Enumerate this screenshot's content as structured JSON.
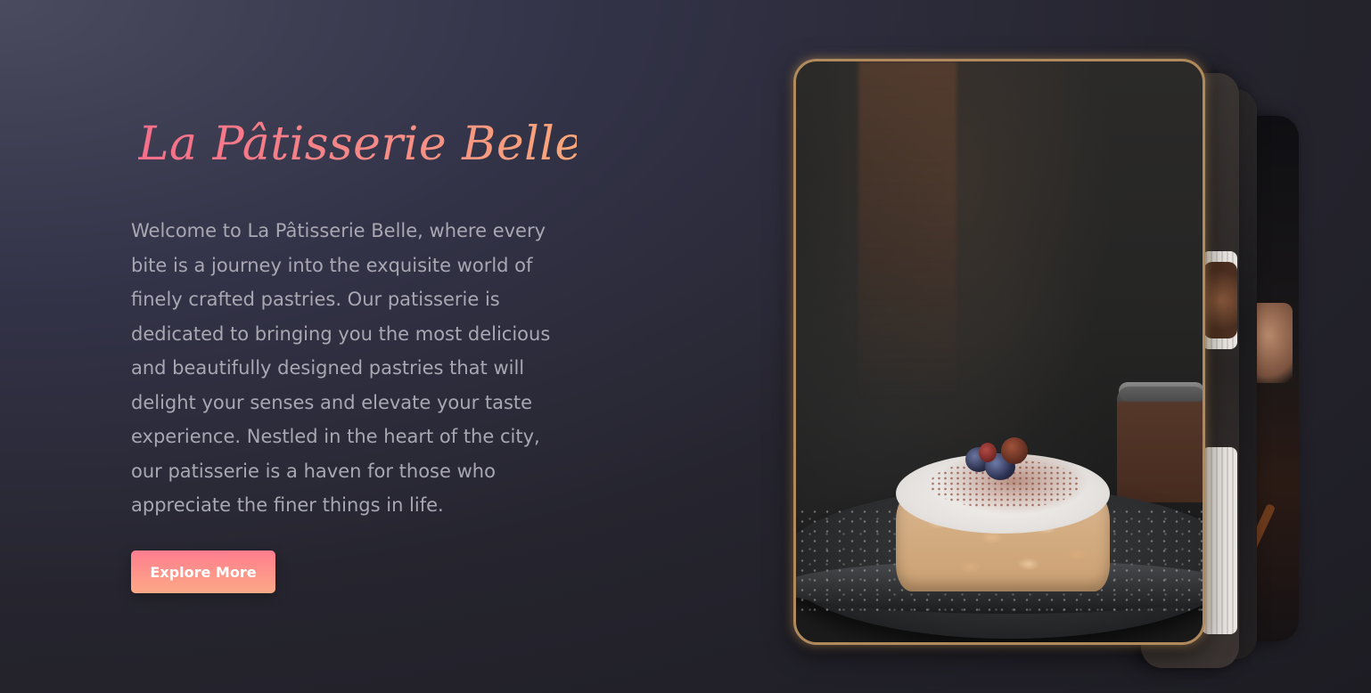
{
  "hero": {
    "title": "La Pâtisserie Belle",
    "intro": "Welcome to La Pâtisserie Belle, where every bite is a journey into the exquisite world of finely crafted pastries. Our patisserie is dedicated to bringing you the most delicious and beautifully designed pastries that will delight your senses and elevate your taste experience. Nestled in the heart of the city, our patisserie is a haven for those who appreciate the finer things in life.",
    "cta_label": "Explore More"
  },
  "gallery": {
    "cards": [
      {
        "name": "cake-with-almonds-photo"
      },
      {
        "name": "pastry-cups-photo"
      },
      {
        "name": "berries-photo"
      },
      {
        "name": "baker-hands-photo"
      }
    ]
  },
  "colors": {
    "title_gradient_start": "#f56e8b",
    "title_gradient_end": "#f9a77a",
    "button_gradient_start": "#ff7d8e",
    "button_gradient_end": "#fca987",
    "frame_gold": "#b08a5c",
    "body_text": "#a8a7b2"
  }
}
